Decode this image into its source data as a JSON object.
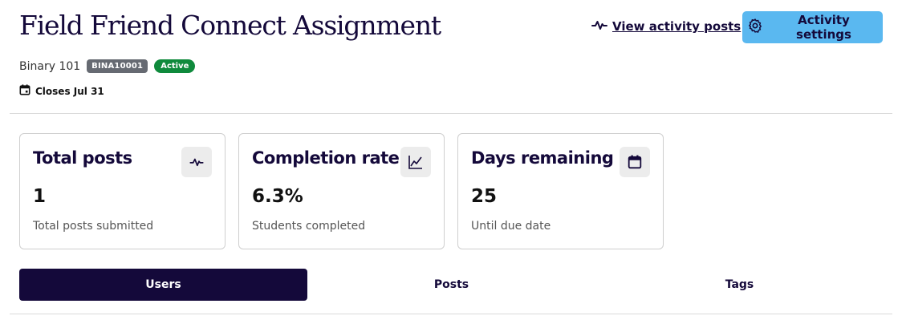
{
  "header": {
    "title": "Field Friend Connect Assignment",
    "view_posts_label": "View activity posts",
    "settings_label": "Activity settings"
  },
  "meta": {
    "course": "Binary 101",
    "code": "BINA10001",
    "status": "Active",
    "closes": "Closes Jul 31"
  },
  "stats": [
    {
      "title": "Total posts",
      "value": "1",
      "subtitle": "Total posts submitted",
      "icon": "activity-icon"
    },
    {
      "title": "Completion rate",
      "value": "6.3%",
      "subtitle": "Students completed",
      "icon": "line-chart-icon"
    },
    {
      "title": "Days remaining",
      "value": "25",
      "subtitle": "Until due date",
      "icon": "calendar-icon"
    }
  ],
  "tabs": [
    {
      "label": "Users",
      "active": true
    },
    {
      "label": "Posts",
      "active": false
    },
    {
      "label": "Tags",
      "active": false
    }
  ],
  "colors": {
    "primary": "#14093a",
    "accent": "#5ab8f0",
    "status_active": "#0f8a3c",
    "badge_gray": "#666a72"
  }
}
